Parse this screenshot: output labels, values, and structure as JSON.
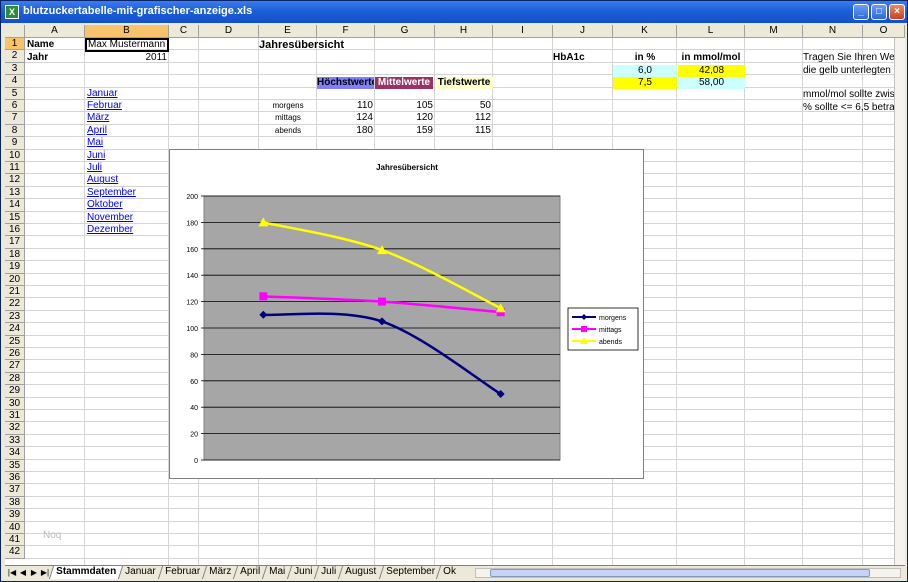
{
  "window": {
    "title": "blutzuckertabelle-mit-grafischer-anzeige.xls",
    "app_icon": "excel-icon"
  },
  "columns": [
    "A",
    "B",
    "C",
    "D",
    "E",
    "F",
    "G",
    "H",
    "I",
    "J",
    "K",
    "L",
    "M",
    "N",
    "O"
  ],
  "rows": [
    "1",
    "2",
    "3",
    "4",
    "5",
    "6",
    "7",
    "8",
    "9",
    "10",
    "11",
    "12",
    "13",
    "14",
    "15",
    "16",
    "17",
    "18",
    "19",
    "20",
    "21",
    "22",
    "23",
    "24",
    "25",
    "26",
    "27",
    "28",
    "29",
    "30",
    "31",
    "32",
    "33",
    "34",
    "35",
    "36",
    "37",
    "38",
    "39",
    "40",
    "41",
    "42"
  ],
  "cells": {
    "name_label": "Name",
    "name_value": "Max Mustermann",
    "year_label": "Jahr",
    "year_value": "2011",
    "annual_title": "Jahresübersicht",
    "hba1c_label": "HbA1c",
    "in_percent": "in %",
    "in_mmol": "in mmol/mol",
    "k3": "6,0",
    "l3": "42,08",
    "k4": "7,5",
    "l4": "58,00",
    "hint1": "Tragen Sie Ihren Wer",
    "hint2": "die gelb unterlegten Z",
    "hint3": "mmol/mol sollte zwis",
    "hint4": "% sollte <= 6,5 betra",
    "hoechst": "Höchstwerte",
    "mittel": "Mittelwerte",
    "tiefst": "Tiefstwerte",
    "watermark": "Noq"
  },
  "months": [
    "Januar",
    "Februar",
    "März",
    "April",
    "Mai",
    "Juni",
    "Juli",
    "August",
    "September",
    "Oktober",
    "November",
    "Dezember"
  ],
  "table": [
    {
      "label": "morgens",
      "values": [
        "110",
        "105",
        "50"
      ]
    },
    {
      "label": "mittags",
      "values": [
        "124",
        "120",
        "112"
      ]
    },
    {
      "label": "abends",
      "values": [
        "180",
        "159",
        "115"
      ]
    }
  ],
  "tabs": [
    "Stammdaten",
    "Januar",
    "Februar",
    "März",
    "April",
    "Mai",
    "Juni",
    "Juli",
    "August",
    "September",
    "Ok"
  ],
  "colors": {
    "hoechst_bg": "#8080ff",
    "mittel_bg": "#993366",
    "tiefst_bg": "#ffffcc",
    "cyan_bg": "#ccffff",
    "yellow_bg": "#ffff00",
    "plot_bg": "#a6a6a6"
  },
  "chart_data": {
    "type": "line",
    "title": "Jahresübersicht",
    "categories": [
      "Höchstwerte",
      "Mittelwerte",
      "Tiefstwerte"
    ],
    "ylim": [
      0,
      200
    ],
    "yticks": [
      "0",
      "20",
      "40",
      "60",
      "80",
      "100",
      "120",
      "140",
      "160",
      "180",
      "200"
    ],
    "grid": true,
    "legend_position": "right",
    "series": [
      {
        "name": "morgens",
        "values": [
          110,
          105,
          50
        ],
        "color": "#000080",
        "marker": "diamond"
      },
      {
        "name": "mittags",
        "values": [
          124,
          120,
          112
        ],
        "color": "#ff00ff",
        "marker": "square"
      },
      {
        "name": "abends",
        "values": [
          180,
          159,
          115
        ],
        "color": "#ffff00",
        "marker": "triangle"
      }
    ]
  }
}
